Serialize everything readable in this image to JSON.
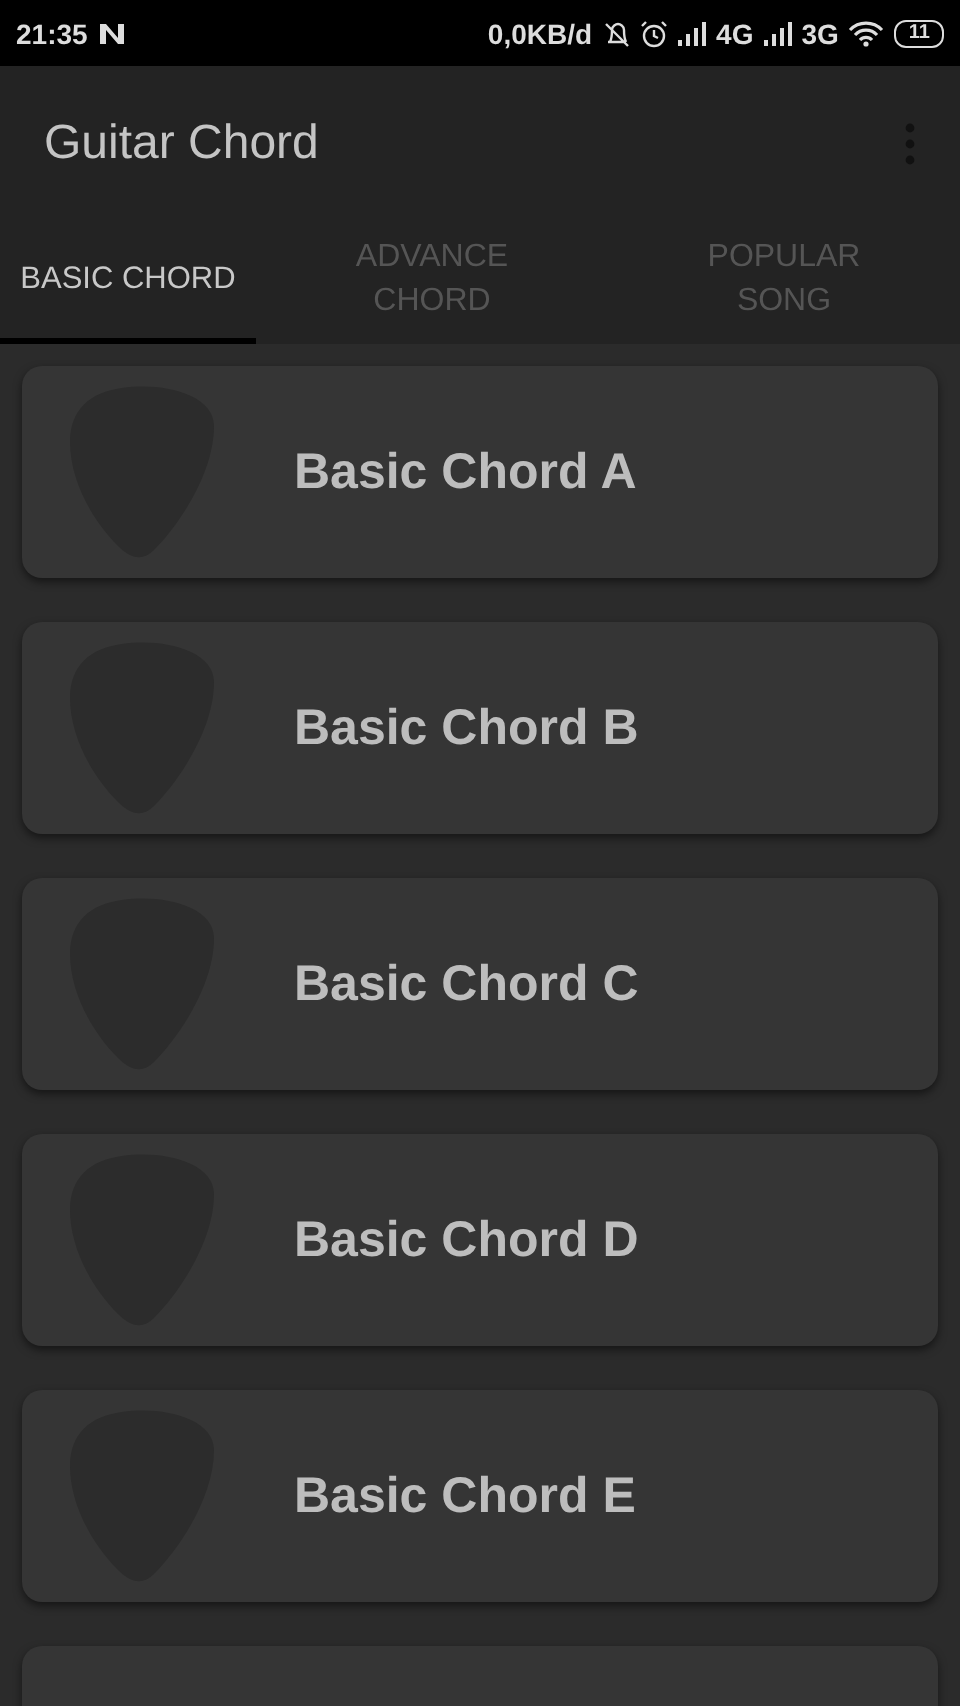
{
  "status_bar": {
    "time": "21:35",
    "data_rate": "0,0KB/d",
    "network_1": "4G",
    "network_2": "3G",
    "battery": "11"
  },
  "app_bar": {
    "title": "Guitar Chord"
  },
  "tabs": [
    {
      "label": "BASIC CHORD",
      "selected": true
    },
    {
      "label": "ADVANCE CHORD",
      "selected": false
    },
    {
      "label": "POPULAR SONG",
      "selected": false
    }
  ],
  "items": [
    {
      "title": "Basic Chord A"
    },
    {
      "title": "Basic Chord B"
    },
    {
      "title": "Basic Chord C"
    },
    {
      "title": "Basic Chord D"
    },
    {
      "title": "Basic Chord E"
    }
  ]
}
